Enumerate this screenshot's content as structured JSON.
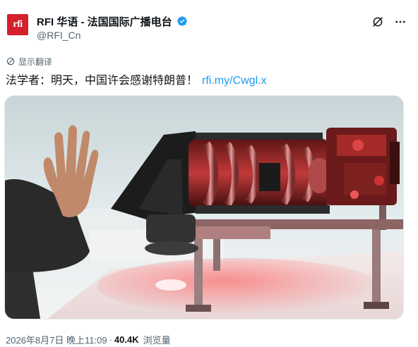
{
  "account": {
    "avatar_text": "rfi",
    "display_name": "RFI 华语 - 法国国际广播电台",
    "handle": "@RFI_Cn"
  },
  "translate": {
    "label": "显示翻译"
  },
  "post": {
    "text": "法学者：明天，中国许会感谢特朗普！",
    "link": "rfi.my/Cwgl.x"
  },
  "footer": {
    "datetime": "2026年8月7日 晚上11:09",
    "separator": "·",
    "views_count": "40.4K",
    "views_label": "浏览量"
  },
  "colors": {
    "brand": "#d3202a",
    "link": "#1d9bf0",
    "secondary_text": "#536471",
    "verified": "#1d9bf0"
  },
  "icons": {
    "verified": "verified-badge-icon",
    "grok": "grok-icon",
    "more": "more-dots-icon",
    "translate": "translate-icon"
  }
}
